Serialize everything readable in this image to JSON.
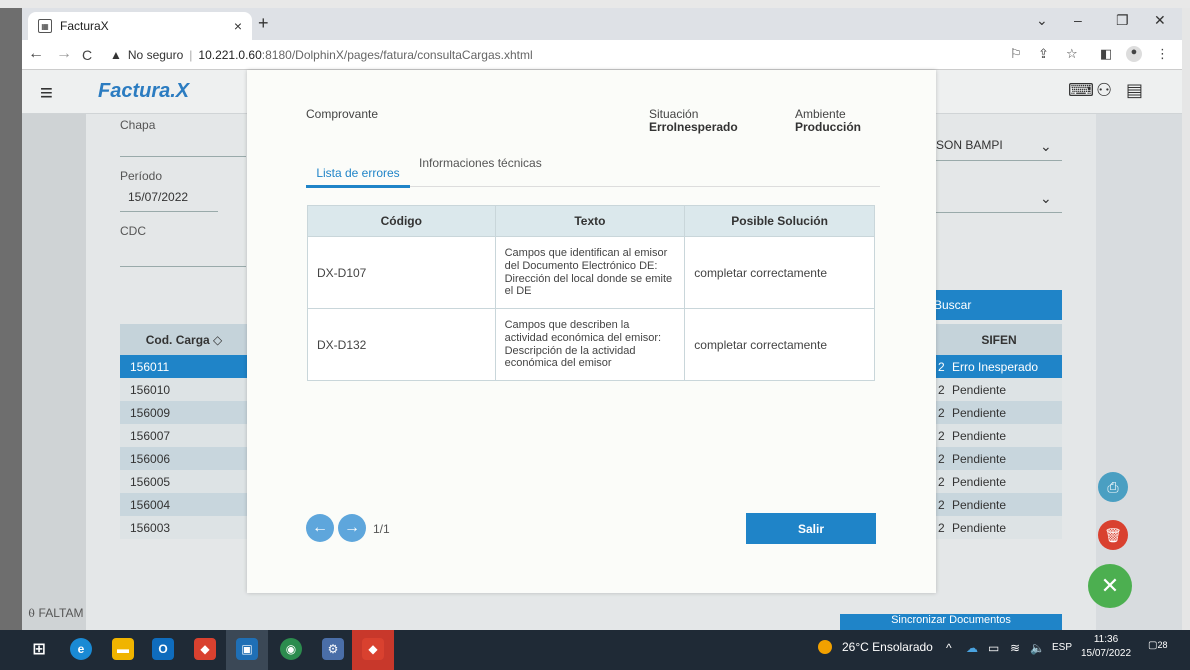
{
  "browser": {
    "tab_title": "FacturaX",
    "tab_close": "×",
    "new_tab": "+",
    "url_warning": "No seguro",
    "url_host": "10.221.0.60",
    "url_path": ":8180/DolphinX/pages/fatura/consultaCargas.xhtml"
  },
  "app": {
    "logo": "Factura.X"
  },
  "background": {
    "chapa_label": "Chapa",
    "periodo_label": "Período",
    "periodo_value": "15/07/2022",
    "cdc_label": "CDC",
    "user_value": "SON BAMPI",
    "buscar_label": "Buscar",
    "grid_col_carga": "Cod. Carga ◇",
    "grid_col_sifen": "SIFEN",
    "rows": [
      {
        "carga": "156011",
        "n": "2",
        "sifen": "Erro Inesperado"
      },
      {
        "carga": "156010",
        "n": "2",
        "sifen": "Pendiente"
      },
      {
        "carga": "156009",
        "n": "2",
        "sifen": "Pendiente"
      },
      {
        "carga": "156007",
        "n": "2",
        "sifen": "Pendiente"
      },
      {
        "carga": "156006",
        "n": "2",
        "sifen": "Pendiente"
      },
      {
        "carga": "156005",
        "n": "2",
        "sifen": "Pendiente"
      },
      {
        "carga": "156004",
        "n": "2",
        "sifen": "Pendiente"
      },
      {
        "carga": "156003",
        "n": "2",
        "sifen": "Pendiente"
      }
    ],
    "faltam_label": "FALTAM",
    "sync_label": "Sincronizar Documentos"
  },
  "modal": {
    "comprovante_label": "Comprovante",
    "situacion_label": "Situación",
    "situacion_value": "ErroInesperado",
    "ambiente_label": "Ambiente",
    "ambiente_value": "Producción",
    "tab_errors": "Lista de errores",
    "tab_tech": "Informaciones técnicas",
    "table_headers": [
      "Código",
      "Texto",
      "Posible Solución"
    ],
    "errors": [
      {
        "codigo": "DX-D107",
        "texto": "Campos que identifican al emisor del Documento Electrónico DE: Dirección del local donde se emite el DE",
        "solucion": "completar correctamente"
      },
      {
        "codigo": "DX-D132",
        "texto": "Campos que describen la actividad económica del emisor: Descripción de la actividad económica del emisor",
        "solucion": "completar correctamente"
      }
    ],
    "page_info": "1/1",
    "salir_label": "Salir"
  },
  "taskbar": {
    "weather": "26°C  Ensolarado",
    "lang": "ESP",
    "time": "11:36",
    "date": "15/07/2022",
    "notifications": "28"
  },
  "colors": {
    "accent": "#1f84c8",
    "danger": "#d9412f",
    "success": "#4caf50"
  }
}
